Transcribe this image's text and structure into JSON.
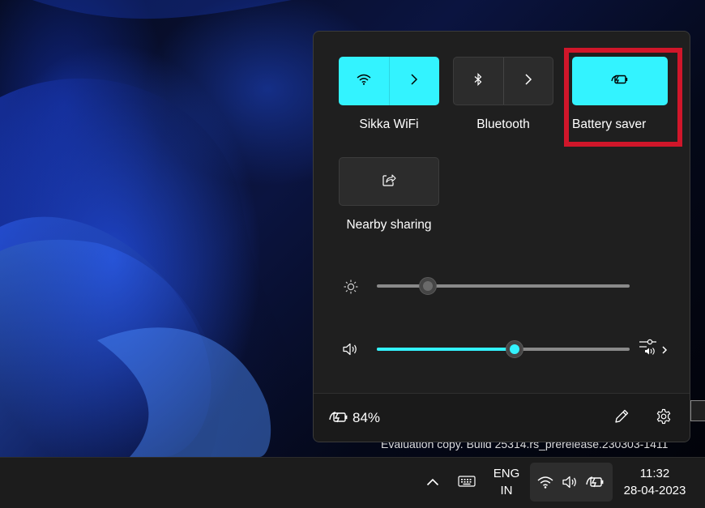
{
  "desktop": {
    "watermark": "Evaluation copy. Build 25314.rs_prerelease.230303-1411"
  },
  "quick_settings": {
    "tiles": [
      {
        "label": "Sikka WiFi",
        "icon": "wifi-icon",
        "state": "on",
        "has_expand": true
      },
      {
        "label": "Bluetooth",
        "icon": "bluetooth-icon",
        "state": "off",
        "has_expand": true
      },
      {
        "label": "Battery saver",
        "icon": "battery-saver-icon",
        "state": "on",
        "has_expand": false,
        "highlighted": true
      },
      {
        "label": "Nearby sharing",
        "icon": "share-icon",
        "state": "off",
        "has_expand": false
      }
    ],
    "brightness": {
      "icon": "brightness-icon",
      "level": 0.15
    },
    "volume": {
      "icon": "speaker-icon",
      "level": 0.55,
      "extra_icon": "audio-output-icon"
    },
    "footer": {
      "battery_icon": "battery-charging-icon",
      "battery_percent": "84%",
      "edit_icon": "pencil-icon",
      "settings_icon": "gear-icon"
    }
  },
  "taskbar": {
    "language_line1": "ENG",
    "language_line2": "IN",
    "time": "11:32",
    "date": "28-04-2023",
    "tray_icons": [
      "chevron-up-icon",
      "keyboard-icon",
      "wifi-icon",
      "speaker-icon",
      "battery-charging-icon"
    ]
  },
  "colors": {
    "accent": "#33f3ff",
    "highlight_box": "#d0162a",
    "panel_bg": "#1f1f1f",
    "taskbar_bg": "#1c1c1c"
  }
}
